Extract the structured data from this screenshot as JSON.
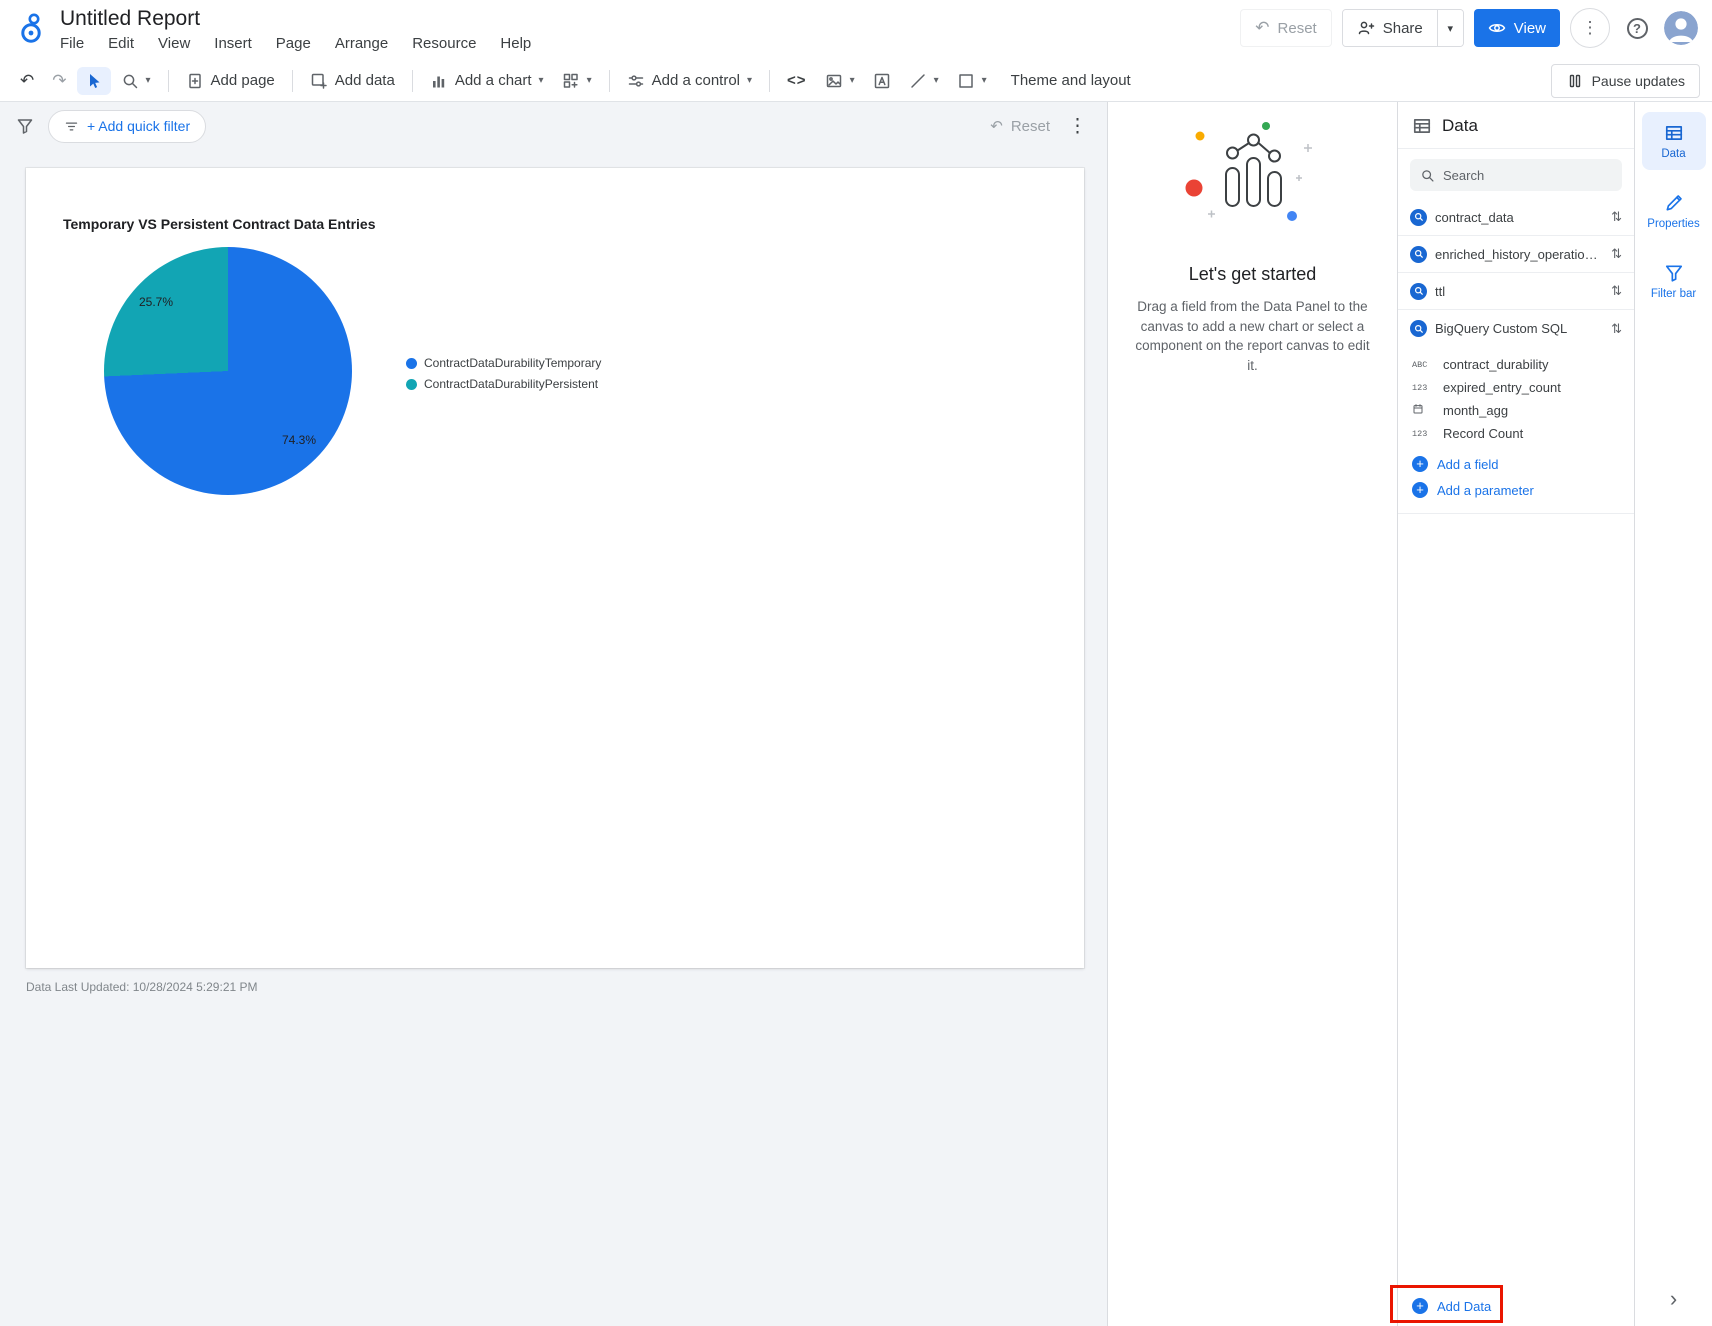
{
  "header": {
    "title": "Untitled Report",
    "menus": [
      "File",
      "Edit",
      "View",
      "Insert",
      "Page",
      "Arrange",
      "Resource",
      "Help"
    ],
    "reset_label": "Reset",
    "share_label": "Share",
    "view_label": "View"
  },
  "toolbar": {
    "add_page": "Add page",
    "add_data": "Add data",
    "add_chart": "Add a chart",
    "add_control": "Add a control",
    "theme_layout": "Theme and layout",
    "pause_updates": "Pause updates"
  },
  "filter_bar": {
    "add_quick_filter": "+ Add quick filter",
    "reset_label": "Reset"
  },
  "chart_data": {
    "type": "pie",
    "title": "Temporary VS Persistent Contract Data Entries",
    "labels": [
      "ContractDataDurabilityTemporary",
      "ContractDataDurabilityPersistent"
    ],
    "values": [
      74.3,
      25.7
    ],
    "value_labels": [
      "74.3%",
      "25.7%"
    ],
    "colors": [
      "#1a73e8",
      "#12a5b4"
    ],
    "legend_position": "right"
  },
  "canvas": {
    "last_updated": "Data Last Updated: 10/28/2024 5:29:21 PM"
  },
  "getting_started": {
    "title": "Let's get started",
    "body": "Drag a field from the Data Panel to the canvas to add a new chart or select a component on the report canvas to edit it."
  },
  "data_panel": {
    "title": "Data",
    "search_placeholder": "Search",
    "sources": [
      {
        "name": "contract_data"
      },
      {
        "name": "enriched_history_operations_sorob..."
      },
      {
        "name": "ttl"
      },
      {
        "name": "BigQuery Custom SQL"
      }
    ],
    "fields": [
      {
        "abbr": "ABC",
        "type": "text",
        "name": "contract_durability"
      },
      {
        "abbr": "123",
        "type": "number",
        "name": "expired_entry_count"
      },
      {
        "abbr": "",
        "type": "date",
        "name": "month_agg"
      },
      {
        "abbr": "123",
        "type": "number",
        "name": "Record Count"
      }
    ],
    "add_field": "Add a field",
    "add_parameter": "Add a parameter",
    "add_data": "Add Data"
  },
  "right_rail": {
    "tabs": [
      "Data",
      "Properties",
      "Filter bar"
    ]
  },
  "annotation": {
    "color": "#ea1500"
  }
}
